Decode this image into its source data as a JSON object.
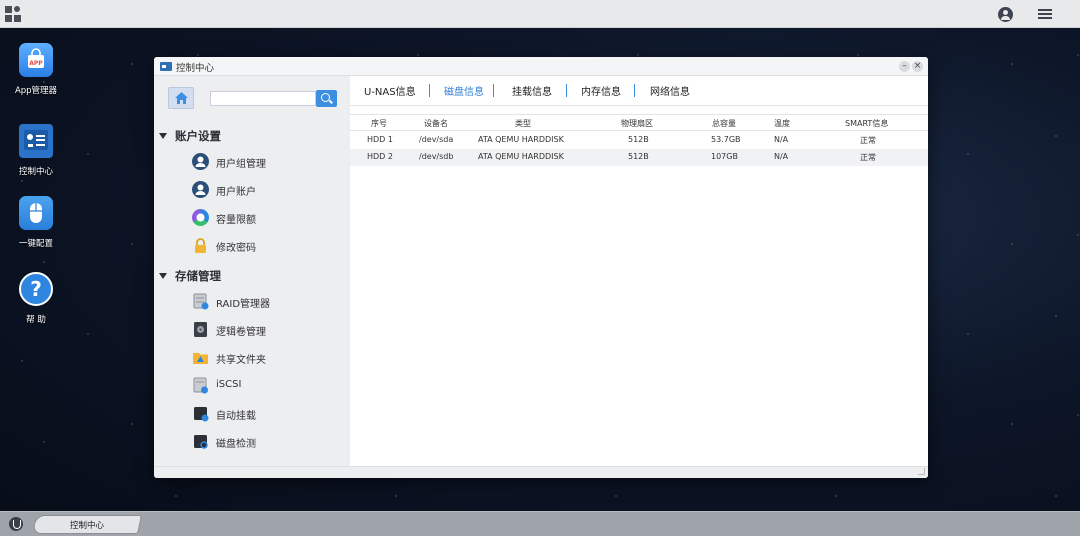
{
  "desktop": {
    "icons": [
      {
        "label": "App管理器",
        "icon": "app-store-icon"
      },
      {
        "label": "控制中心",
        "icon": "control-panel-icon"
      },
      {
        "label": "一键配置",
        "icon": "mouse-icon"
      },
      {
        "label": "帮 助",
        "icon": "help-icon"
      }
    ]
  },
  "window": {
    "title": "控制中心",
    "minimize_label": "–",
    "close_label": "×"
  },
  "search": {
    "placeholder": "",
    "value": ""
  },
  "sidebar": {
    "sections": [
      {
        "label": "账户设置",
        "items": [
          {
            "label": "用户组管理",
            "icon": "user-group-icon"
          },
          {
            "label": "用户账户",
            "icon": "user-account-icon"
          },
          {
            "label": "容量限额",
            "icon": "quota-icon"
          },
          {
            "label": "修改密码",
            "icon": "lock-icon"
          }
        ]
      },
      {
        "label": "存储管理",
        "items": [
          {
            "label": "RAID管理器",
            "icon": "raid-icon"
          },
          {
            "label": "逻辑卷管理",
            "icon": "volume-icon"
          },
          {
            "label": "共享文件夹",
            "icon": "shared-folder-icon"
          },
          {
            "label": "iSCSI",
            "icon": "iscsi-icon"
          },
          {
            "label": "自动挂载",
            "icon": "automount-icon"
          },
          {
            "label": "磁盘检测",
            "icon": "disk-check-icon"
          }
        ]
      }
    ]
  },
  "tabs": [
    {
      "label": "U-NAS信息",
      "active": false
    },
    {
      "label": "磁盘信息",
      "active": true
    },
    {
      "label": "挂载信息",
      "active": false
    },
    {
      "label": "内存信息",
      "active": false
    },
    {
      "label": "网络信息",
      "active": false
    }
  ],
  "table": {
    "headers": [
      "序号",
      "设备名",
      "类型",
      "物理扇区",
      "总容量",
      "温度",
      "SMART信息"
    ],
    "rows": [
      [
        "HDD 1",
        "/dev/sda",
        "ATA QEMU HARDDISK",
        "512B",
        "53.7GB",
        "N/A",
        "正常"
      ],
      [
        "HDD 2",
        "/dev/sdb",
        "ATA QEMU HARDDISK",
        "512B",
        "107GB",
        "N/A",
        "正常"
      ]
    ]
  },
  "taskbar": {
    "items": [
      {
        "label": "控制中心"
      }
    ]
  },
  "colors": {
    "accent": "#3c8fe0",
    "active_tab": "#2f7fd6"
  }
}
